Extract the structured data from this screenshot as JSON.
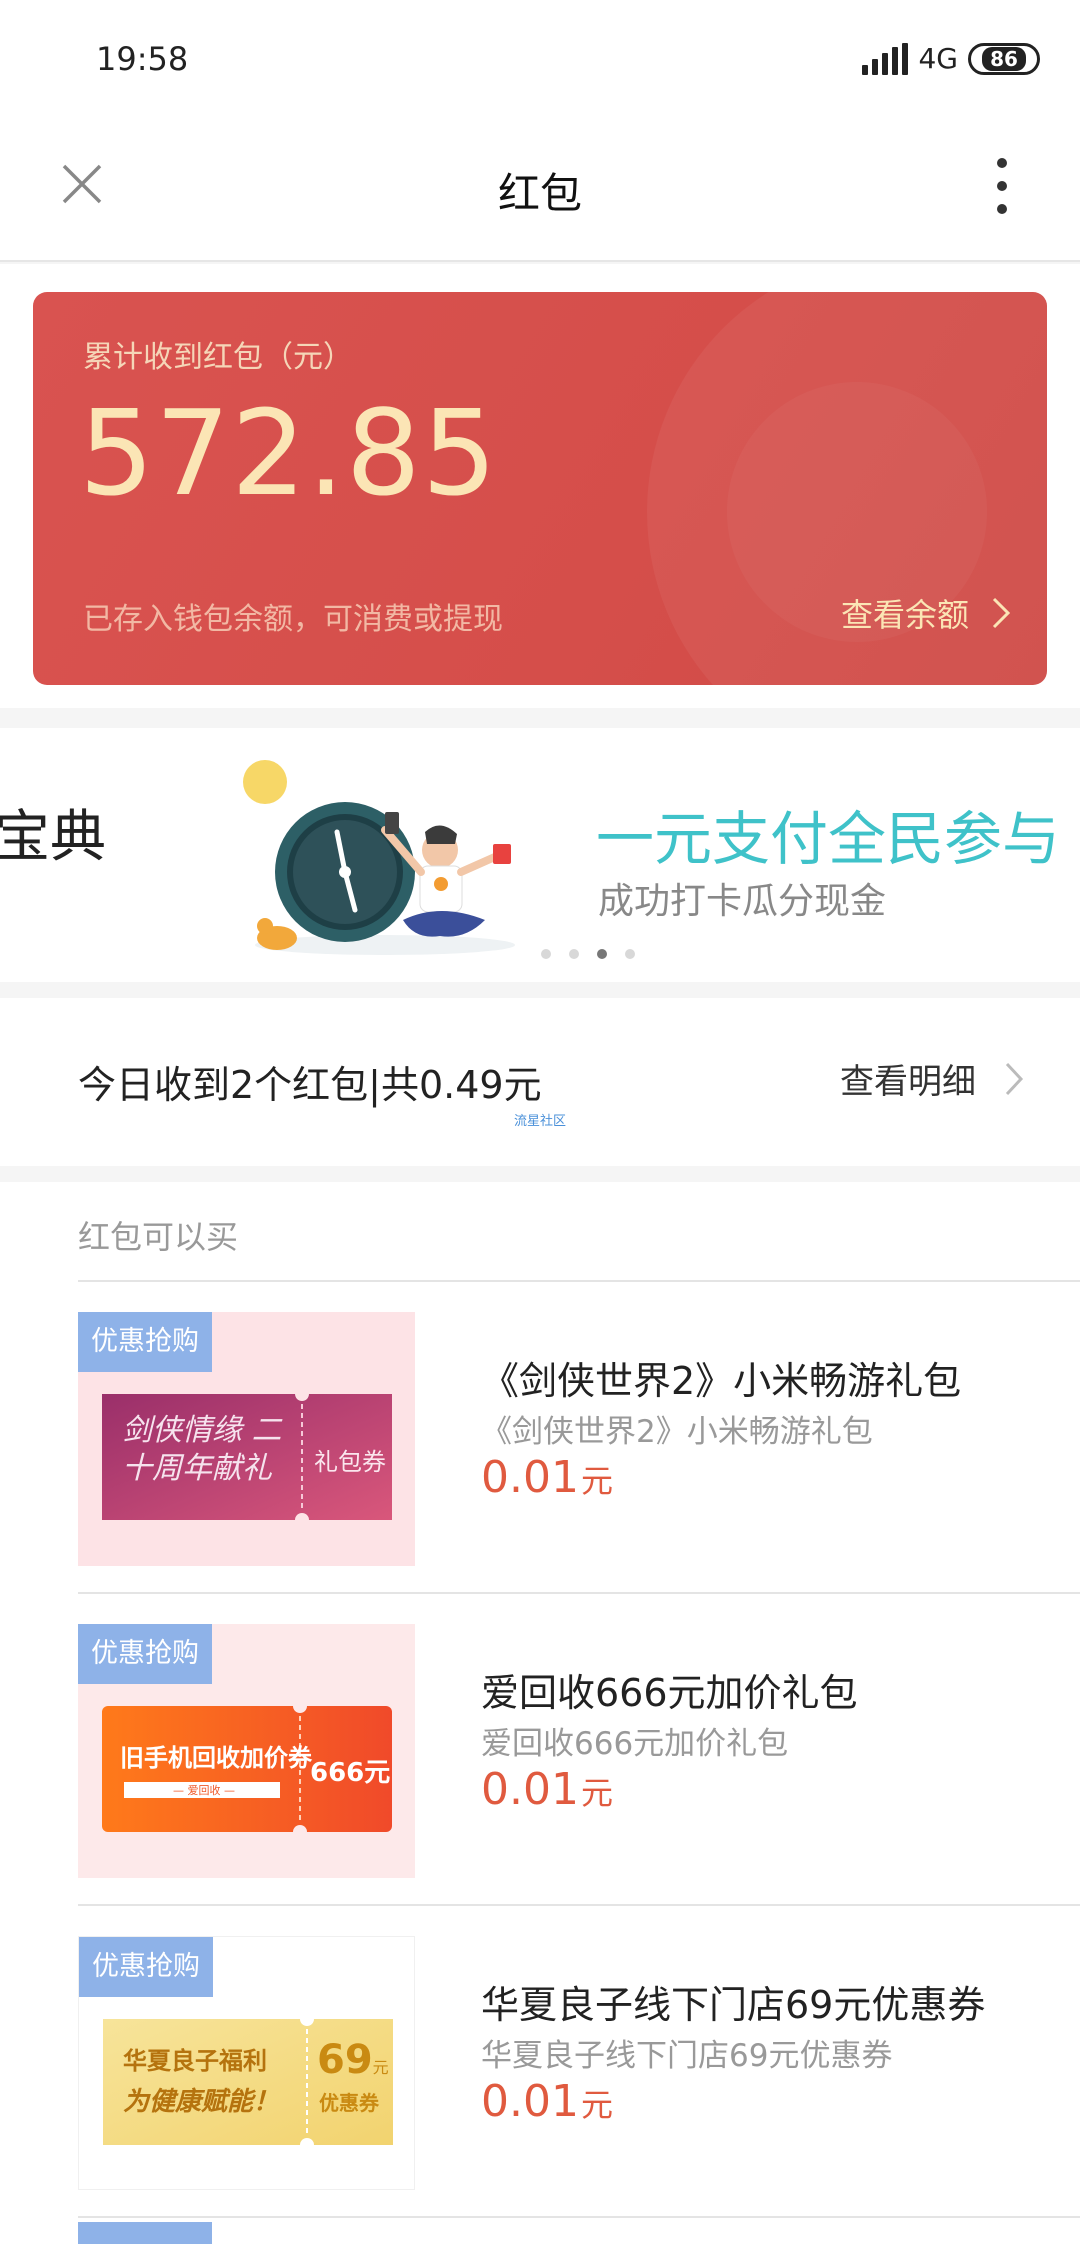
{
  "status_bar": {
    "time": "19:58",
    "network": "4G",
    "battery": "86"
  },
  "header": {
    "title": "红包"
  },
  "balance_card": {
    "label": "累计收到红包（元）",
    "amount": "572.85",
    "note": "已存入钱包余额，可消费或提现",
    "view_label": "查看余额"
  },
  "banner": {
    "left_text": "宝典",
    "headline": "一元支付全民参与",
    "subline": "成功打卡瓜分现金",
    "dots": 4,
    "active_dot": 2
  },
  "today": {
    "summary": "今日收到2个红包|共0.49元",
    "link_label": "查看明细",
    "watermark": "流星社区"
  },
  "products": {
    "section_title": "红包可以买",
    "items": [
      {
        "tag": "优惠抢购",
        "name": "《剑侠世界2》小米畅游礼包",
        "desc": "《剑侠世界2》小米畅游礼包",
        "price": "0.01",
        "unit": "元",
        "coupon_main": "剑侠情缘 二十周年献礼",
        "coupon_side": "礼包券"
      },
      {
        "tag": "优惠抢购",
        "name": "爱回收666元加价礼包",
        "desc": "爱回收666元加价礼包",
        "price": "0.01",
        "unit": "元",
        "coupon_main": "旧手机回收加价券",
        "coupon_sub": "— 爱回收 —",
        "coupon_side": "666元"
      },
      {
        "tag": "优惠抢购",
        "name": "华夏良子线下门店69元优惠券",
        "desc": "华夏良子线下门店69元优惠券",
        "price": "0.01",
        "unit": "元",
        "coupon_main_1": "华夏良子福利",
        "coupon_main_2": "为健康赋能！",
        "coupon_side_num": "69",
        "coupon_side_unit": "元",
        "coupon_side_label": "优惠券"
      }
    ]
  },
  "colors": {
    "card_red": "#d95350",
    "amount_gold": "#fbe5b5",
    "price_red": "#e05a3f",
    "tag_blue": "#8eb2e8",
    "headline_teal": "#3fc2c9"
  }
}
